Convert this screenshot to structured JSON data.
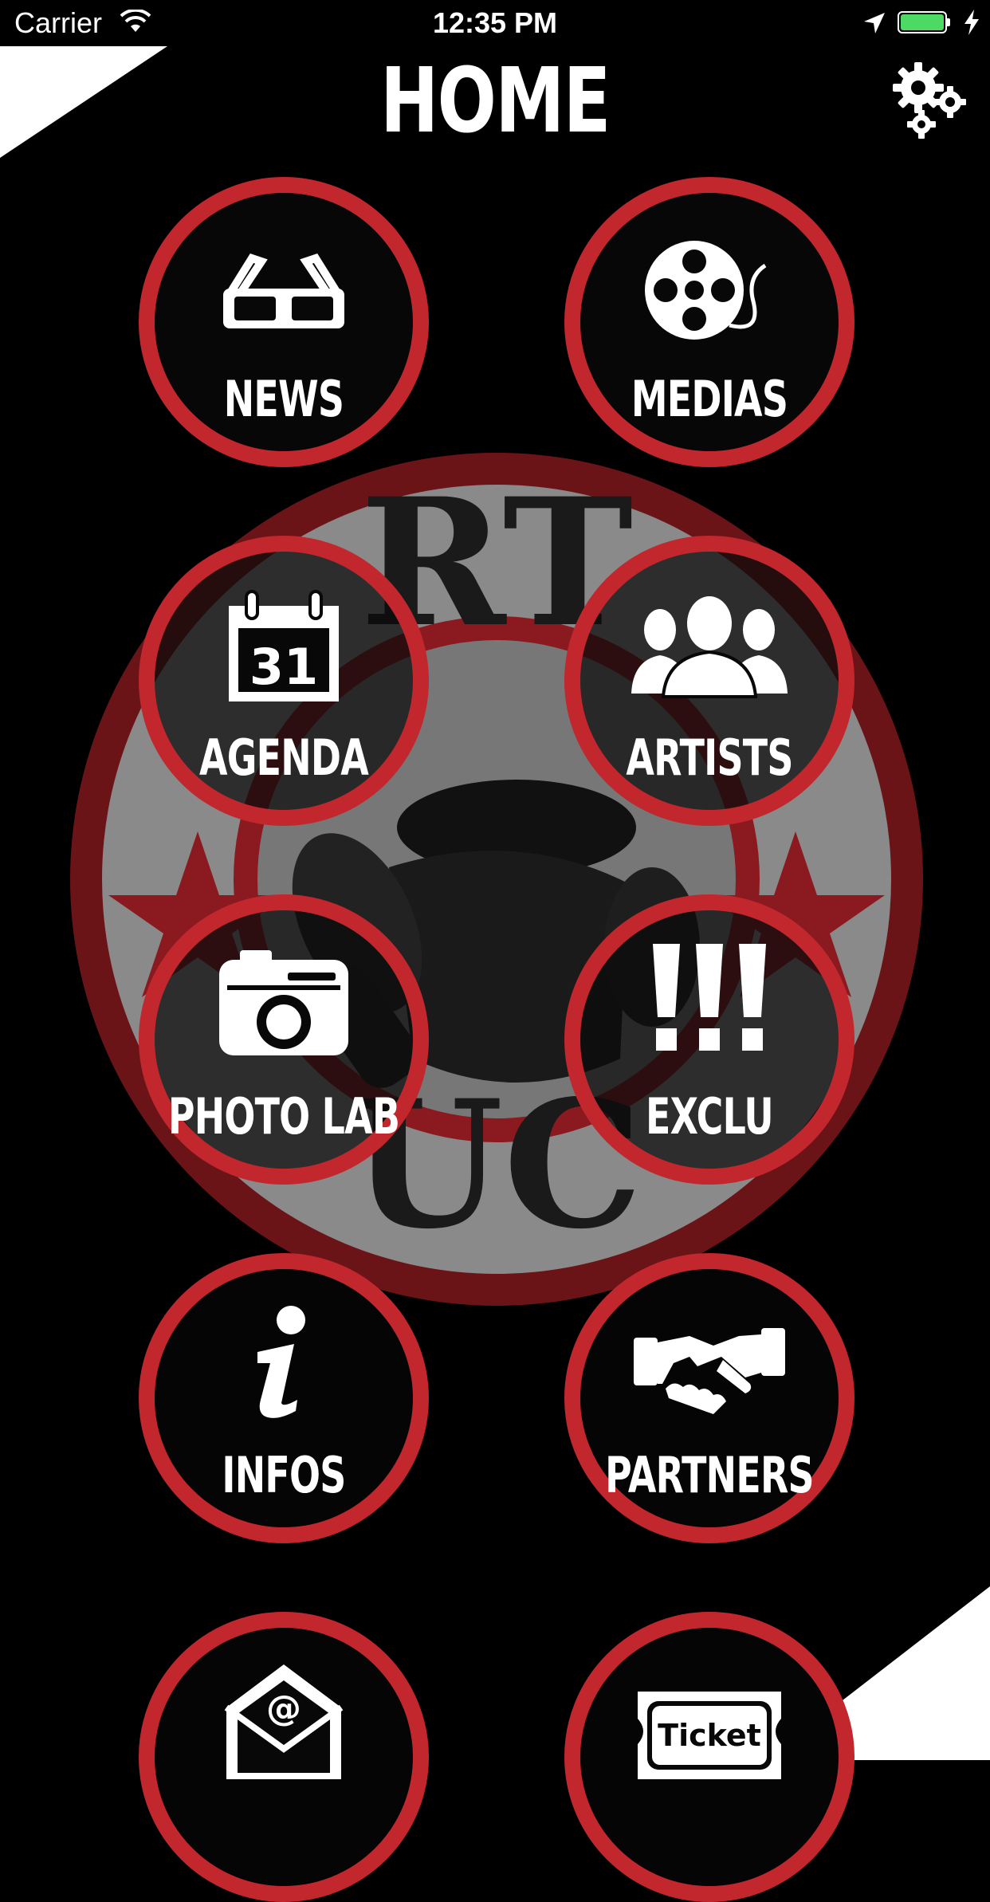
{
  "status_bar": {
    "carrier": "Carrier",
    "time": "12:35 PM",
    "battery_level": 1.0,
    "battery_color": "#4cd964"
  },
  "header": {
    "title": "HOME",
    "settings_icon": "gears-icon"
  },
  "accent_color": "#c1272d",
  "background_logo": {
    "letters_top": "RT",
    "letters_bottom": "UC"
  },
  "menu": {
    "items": [
      {
        "label": "NEWS",
        "icon": "glasses-icon"
      },
      {
        "label": "MEDIAS",
        "icon": "film-reel-icon"
      },
      {
        "label": "AGENDA",
        "icon": "calendar-icon",
        "icon_text": "31"
      },
      {
        "label": "ARTISTS",
        "icon": "people-icon"
      },
      {
        "label": "PHOTO LAB",
        "icon": "camera-icon"
      },
      {
        "label": "EXCLU",
        "icon": "exclamation-icon"
      },
      {
        "label": "INFOS",
        "icon": "info-icon"
      },
      {
        "label": "PARTNERS",
        "icon": "handshake-icon"
      },
      {
        "label": "",
        "icon": "envelope-icon",
        "icon_text": "@"
      },
      {
        "label": "",
        "icon": "ticket-icon",
        "icon_text": "Ticket"
      }
    ]
  }
}
